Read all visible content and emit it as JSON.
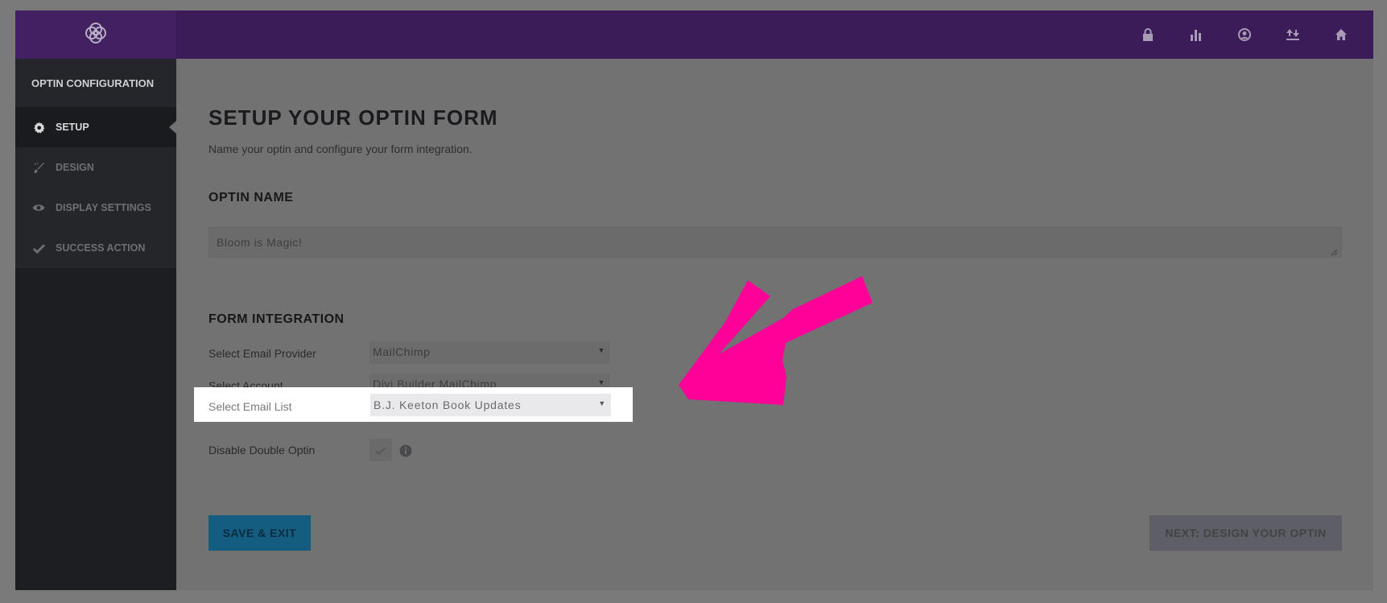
{
  "colors": {
    "topbar": "#3b1b58",
    "sidebar": "#1d1e22",
    "overlay_gray": "#727272",
    "accent_button": "#155d80",
    "annotation_arrow": "#ff0099"
  },
  "topbar": {
    "logo_icon": "bloom-logo-icon",
    "icons": [
      "lock-icon",
      "bar-chart-icon",
      "user-circle-icon",
      "import-export-icon",
      "home-icon"
    ]
  },
  "sidebar": {
    "header": "OPTIN CONFIGURATION",
    "items": [
      {
        "label": "SETUP",
        "icon": "gear-icon",
        "active": true
      },
      {
        "label": "DESIGN",
        "icon": "paint-brush-icon",
        "active": false
      },
      {
        "label": "DISPLAY SETTINGS",
        "icon": "eye-icon",
        "active": false
      },
      {
        "label": "SUCCESS ACTION",
        "icon": "checkmark-icon",
        "active": false
      }
    ]
  },
  "main": {
    "title": "SETUP YOUR OPTIN FORM",
    "subtitle": "Name your optin and configure your form integration.",
    "optin_name": {
      "heading": "OPTIN NAME",
      "value": "Bloom is Magic!"
    },
    "form_integration": {
      "heading": "FORM INTEGRATION",
      "provider_label": "Select Email Provider",
      "provider_value": "MailChimp",
      "account_label": "Select Account",
      "account_value": "Divi Builder MailChimp",
      "list_label": "Select Email List",
      "list_value": "B.J. Keeton Book Updates",
      "double_optin_label": "Disable Double Optin",
      "double_optin_checked": true
    },
    "buttons": {
      "save": "SAVE & EXIT",
      "next": "NEXT: DESIGN YOUR OPTIN"
    }
  }
}
